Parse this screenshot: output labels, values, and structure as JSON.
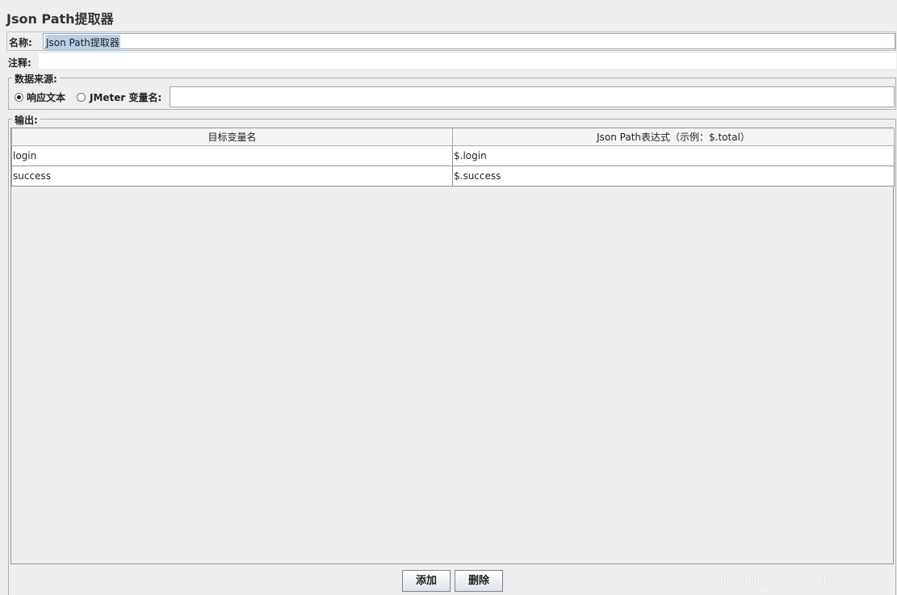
{
  "panel": {
    "title": "Json Path提取器"
  },
  "name_row": {
    "label": "名称:",
    "value": "Json Path提取器"
  },
  "comment_row": {
    "label": "注释:",
    "value": ""
  },
  "source": {
    "legend": "数据来源:",
    "options": [
      {
        "label": "响应文本",
        "checked": true
      },
      {
        "label": "JMeter 变量名:",
        "checked": false
      }
    ],
    "variable_value": ""
  },
  "output": {
    "legend": "输出:",
    "columns": [
      "目标变量名",
      "Json Path表达式（示例：$.total）"
    ],
    "rows": [
      [
        "login",
        "$.login"
      ],
      [
        "success",
        "$.success"
      ]
    ]
  },
  "buttons": {
    "add": "添加",
    "delete": "删除"
  },
  "watermark": "https://blog.csdn.net/q13554515812"
}
